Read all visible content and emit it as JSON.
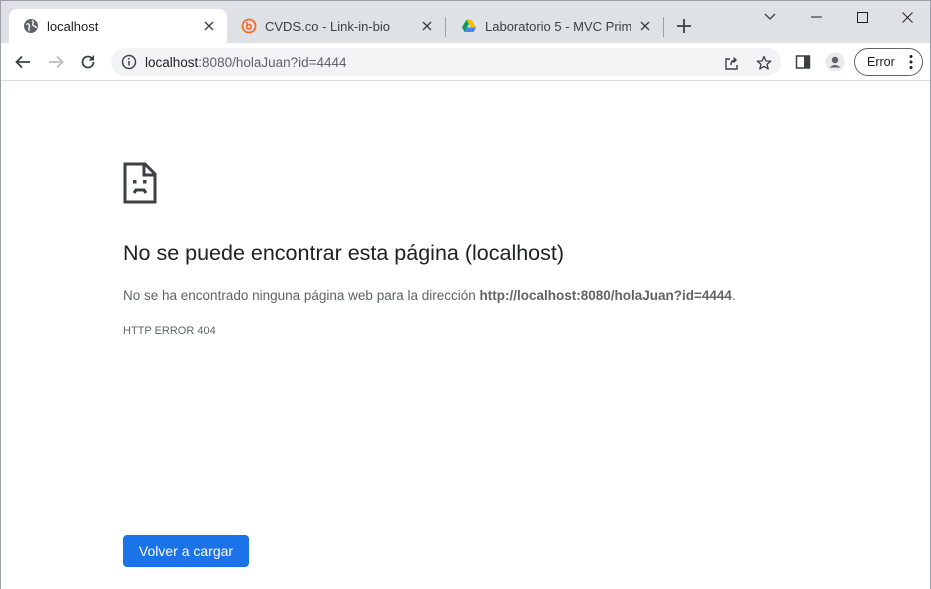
{
  "tabs": [
    {
      "title": "localhost",
      "icon": "globe-icon",
      "active": true
    },
    {
      "title": "CVDS.co - Link-in-bio",
      "icon": "bio-link-icon",
      "active": false
    },
    {
      "title": "Laboratorio 5 - MVC Primefa",
      "icon": "google-drive-icon",
      "active": false
    }
  ],
  "new_tab_icon": "plus-icon",
  "window_controls": [
    "chevron-down-icon",
    "minimize-icon",
    "maximize-icon",
    "close-icon"
  ],
  "omnibox": {
    "host": "localhost",
    "path": ":8080/holaJuan?id=4444",
    "info_icon": "info-icon"
  },
  "toolbar": {
    "error_chip_label": "Error"
  },
  "page": {
    "icon": "sad-page-icon",
    "title": "No se puede encontrar esta página (localhost)",
    "description_prefix": "No se ha encontrado ninguna página web para la dirección ",
    "description_url": "http://localhost:8080/holaJuan?id=4444",
    "description_suffix": ".",
    "error_code": "HTTP ERROR 404",
    "reload_button_label": "Volver a cargar"
  },
  "colors": {
    "tabstrip_bg": "#dee1e6",
    "accent_blue": "#1a73e8",
    "text_primary": "#202124",
    "text_secondary": "#5f6368"
  }
}
